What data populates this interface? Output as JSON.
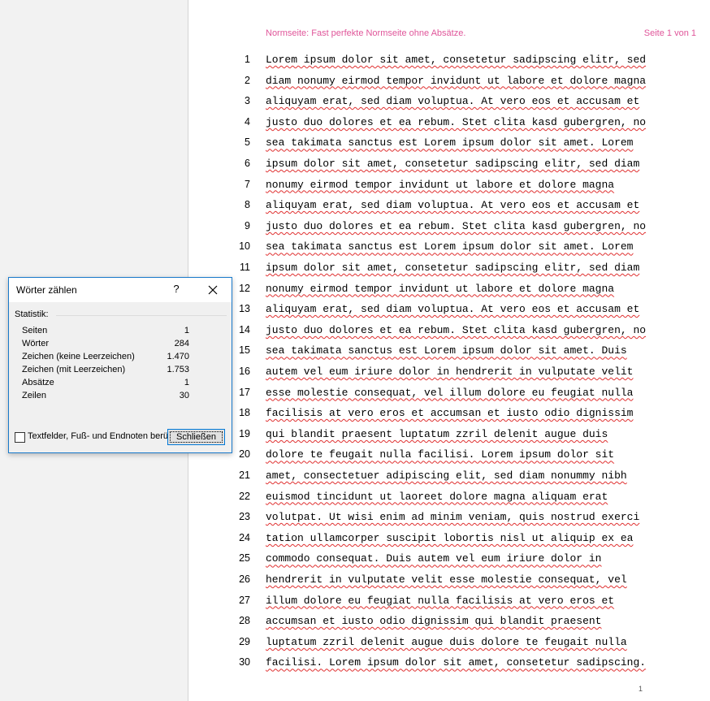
{
  "page": {
    "header_left": "Normseite: Fast perfekte Normseite ohne Absätze.",
    "header_right": "Seite 1 von 1",
    "page_number": "1",
    "lines": [
      {
        "num": "1",
        "text": "Lorem ipsum dolor sit amet, consetetur sadipscing elitr, sed"
      },
      {
        "num": "2",
        "text": "diam nonumy eirmod tempor invidunt ut labore et dolore magna"
      },
      {
        "num": "3",
        "text": "aliquyam erat, sed diam voluptua. At vero eos et accusam et"
      },
      {
        "num": "4",
        "text": "justo duo dolores et ea rebum. Stet clita kasd gubergren, no"
      },
      {
        "num": "5",
        "text": "sea takimata sanctus est Lorem ipsum dolor sit amet. Lorem"
      },
      {
        "num": "6",
        "text": "ipsum dolor sit amet, consetetur sadipscing elitr, sed diam"
      },
      {
        "num": "7",
        "text": "nonumy eirmod tempor invidunt ut labore et dolore magna"
      },
      {
        "num": "8",
        "text": "aliquyam erat, sed diam voluptua. At vero eos et accusam et"
      },
      {
        "num": "9",
        "text": "justo duo dolores et ea rebum. Stet clita kasd gubergren, no"
      },
      {
        "num": "10",
        "text": "sea takimata sanctus est Lorem ipsum dolor sit amet. Lorem"
      },
      {
        "num": "11",
        "text": "ipsum dolor sit amet, consetetur sadipscing elitr, sed diam"
      },
      {
        "num": "12",
        "text": "nonumy eirmod tempor invidunt ut labore et dolore magna"
      },
      {
        "num": "13",
        "text": "aliquyam erat, sed diam voluptua. At vero eos et accusam et"
      },
      {
        "num": "14",
        "text": "justo duo dolores et ea rebum. Stet clita kasd gubergren, no"
      },
      {
        "num": "15",
        "text": "sea takimata sanctus est Lorem ipsum dolor sit amet. Duis"
      },
      {
        "num": "16",
        "text": "autem vel eum iriure dolor in hendrerit in vulputate velit"
      },
      {
        "num": "17",
        "text": "esse molestie consequat, vel illum dolore eu feugiat nulla"
      },
      {
        "num": "18",
        "text": "facilisis at vero eros et accumsan et iusto odio dignissim"
      },
      {
        "num": "19",
        "text": "qui blandit praesent luptatum zzril delenit augue duis"
      },
      {
        "num": "20",
        "text": "dolore te feugait nulla facilisi. Lorem ipsum dolor sit"
      },
      {
        "num": "21",
        "text": "amet, consectetuer adipiscing elit, sed diam nonummy nibh"
      },
      {
        "num": "22",
        "text": "euismod tincidunt ut laoreet dolore magna aliquam erat"
      },
      {
        "num": "23",
        "text": "volutpat. Ut wisi enim ad minim veniam, quis nostrud exerci"
      },
      {
        "num": "24",
        "text": "tation ullamcorper suscipit lobortis nisl ut aliquip ex ea"
      },
      {
        "num": "25",
        "text": "commodo consequat. Duis autem vel eum iriure dolor in"
      },
      {
        "num": "26",
        "text": "hendrerit in vulputate velit esse molestie consequat, vel"
      },
      {
        "num": "27",
        "text": "illum dolore eu feugiat nulla facilisis at vero eros et"
      },
      {
        "num": "28",
        "text": "accumsan et iusto odio dignissim qui blandit praesent"
      },
      {
        "num": "29",
        "text": "luptatum zzril delenit augue duis dolore te feugait nulla"
      },
      {
        "num": "30",
        "text": "facilisi. Lorem ipsum dolor sit amet, consetetur sadipscing."
      }
    ]
  },
  "dialog": {
    "title": "Wörter zählen",
    "help_label": "?",
    "close_icon": "close-icon",
    "group_label": "Statistik:",
    "stats": [
      {
        "label": "Seiten",
        "value": "1"
      },
      {
        "label": "Wörter",
        "value": "284"
      },
      {
        "label": "Zeichen (keine Leerzeichen)",
        "value": "1.470"
      },
      {
        "label": "Zeichen (mit Leerzeichen)",
        "value": "1.753"
      },
      {
        "label": "Absätze",
        "value": "1"
      },
      {
        "label": "Zeilen",
        "value": "30"
      }
    ],
    "checkbox_label": "Textfelder, Fuß- und Endnoten berücksichtigen",
    "checkbox_checked": false,
    "close_button": "Schließen"
  },
  "colors": {
    "header_text": "#e0569a",
    "dialog_border": "#1979ca",
    "spell_underline": "#e03030"
  }
}
